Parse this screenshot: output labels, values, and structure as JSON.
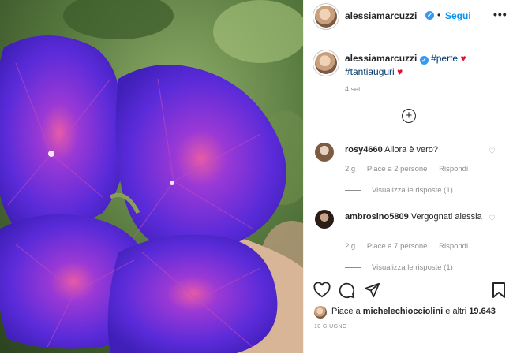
{
  "post_image": {
    "alt": ""
  },
  "header": {
    "username": "alessiamarcuzzi",
    "separator": "•",
    "follow_label": "Segui",
    "more_label": "•••"
  },
  "caption": {
    "username": "alessiamarcuzzi",
    "tags": [
      "#perte",
      "#tantiauguri"
    ],
    "time_ago": "4 sett."
  },
  "load_more_label": "+",
  "comments": [
    {
      "username": "rosy4660",
      "text": "Allora è vero?",
      "time": "2 g",
      "likes_label": "Piace a 2 persone",
      "reply_label": "Rispondi",
      "view_replies_label": "Visualizza le risposte (1)"
    },
    {
      "username": "ambrosino5809",
      "text": "Vergognati alessia",
      "time": "2 g",
      "likes_label": "Piace a 7 persone",
      "reply_label": "Rispondi",
      "view_replies_label": "Visualizza le risposte (1)"
    }
  ],
  "actions": {
    "like_icon": "heart-icon",
    "comment_icon": "comment-icon",
    "share_icon": "paper-plane-icon",
    "save_icon": "bookmark-icon"
  },
  "likes": {
    "prefix": "Piace a ",
    "user": "michelechiocciolini",
    "middle": " e altri ",
    "count": "19.643"
  },
  "date": "10 GIUGNO",
  "colors": {
    "accent": "#0095f6",
    "heart": "#e0102a",
    "tag": "#00376b"
  }
}
